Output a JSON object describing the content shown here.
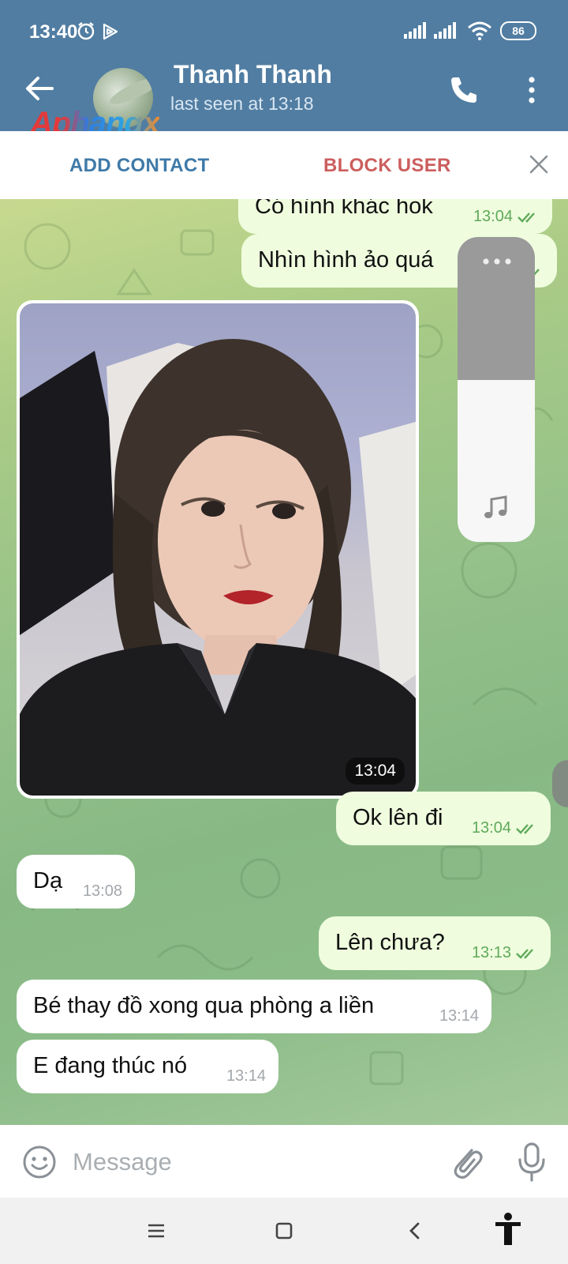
{
  "status_bar": {
    "time": "13:40",
    "battery": "86"
  },
  "header": {
    "contact_name": "Thanh Thanh",
    "last_seen": "last seen at 13:18",
    "watermark": "Aphangx"
  },
  "action_bar": {
    "add_contact": "ADD CONTACT",
    "block_user": "BLOCK USER"
  },
  "messages": [
    {
      "dir": "out",
      "text": "Có hình khác hok",
      "time": "13:04",
      "read": true
    },
    {
      "dir": "out",
      "text": "Nhìn hình ảo quá",
      "time": "",
      "read": true
    },
    {
      "dir": "in",
      "type": "photo",
      "time": "13:04"
    },
    {
      "dir": "out",
      "text": "Ok lên đi",
      "time": "13:04",
      "read": true
    },
    {
      "dir": "in",
      "text": "Dạ",
      "time": "13:08"
    },
    {
      "dir": "out",
      "text": "Lên chưa?",
      "time": "13:13",
      "read": true
    },
    {
      "dir": "in",
      "text": "Bé thay đồ xong qua phòng a liền",
      "time": "13:14"
    },
    {
      "dir": "in",
      "text": "E đang thúc nó",
      "time": "13:14"
    }
  ],
  "volume_panel": {
    "level": 0.53
  },
  "composer": {
    "placeholder": "Message"
  },
  "colors": {
    "header": "#517da2",
    "outgoing_bubble": "#effdde",
    "incoming_bubble": "#ffffff",
    "read_tick": "#5fa95a"
  }
}
